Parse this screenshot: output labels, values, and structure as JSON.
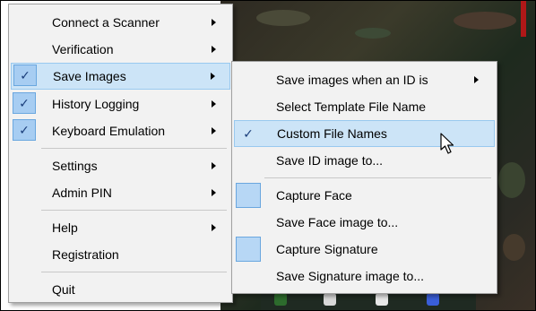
{
  "main_menu": {
    "items": [
      {
        "label": "Connect a Scanner",
        "checked": false,
        "submenu": true
      },
      {
        "label": "Verification",
        "checked": false,
        "submenu": true
      },
      {
        "label": "Save Images",
        "checked": true,
        "submenu": true,
        "highlighted": true
      },
      {
        "label": "History Logging",
        "checked": true,
        "submenu": true
      },
      {
        "label": "Keyboard Emulation",
        "checked": true,
        "submenu": true
      },
      {
        "label": "Settings",
        "checked": false,
        "submenu": true
      },
      {
        "label": "Admin PIN",
        "checked": false,
        "submenu": true
      },
      {
        "label": "Help",
        "checked": false,
        "submenu": true
      },
      {
        "label": "Registration",
        "checked": false,
        "submenu": false
      },
      {
        "label": "Quit",
        "checked": false,
        "submenu": false
      }
    ]
  },
  "sub_menu": {
    "items": [
      {
        "label": "Save images when an ID is",
        "submenu": true
      },
      {
        "label": "Select Template File Name"
      },
      {
        "label": "Custom File Names",
        "checked": true,
        "highlighted": true
      },
      {
        "label": "Save ID image to..."
      },
      {
        "label": "Capture Face",
        "checked": false
      },
      {
        "label": "Save Face image to..."
      },
      {
        "label": "Capture Signature",
        "checked": false
      },
      {
        "label": "Save Signature image to..."
      }
    ]
  },
  "glyphs": {
    "check": "✓"
  },
  "colors": {
    "menu_bg": "#f2f2f2",
    "highlight": "#cce4f7",
    "check_box": "#a7cdf2"
  }
}
